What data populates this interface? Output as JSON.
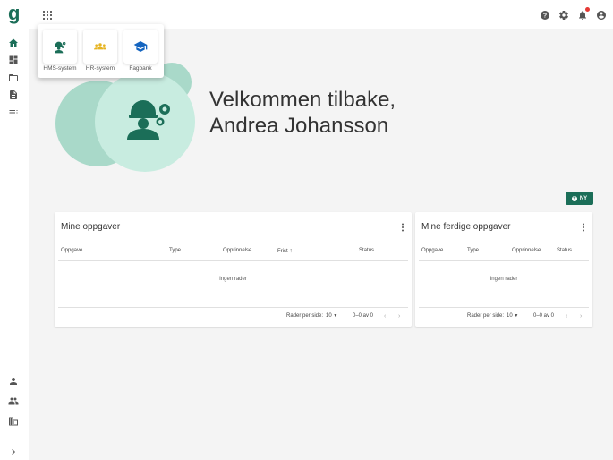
{
  "sidebar": {
    "logo": "g",
    "items": [
      {
        "icon": "home-icon"
      },
      {
        "icon": "dashboard-icon"
      },
      {
        "icon": "folder-icon"
      },
      {
        "icon": "document-icon"
      },
      {
        "icon": "list-icon"
      }
    ],
    "bottom_items": [
      {
        "icon": "person-icon"
      },
      {
        "icon": "people-icon"
      },
      {
        "icon": "building-icon"
      }
    ],
    "expand_icon": "chevron-right-icon"
  },
  "topbar": {
    "icons": [
      "apps-grid-icon",
      "help-icon",
      "settings-icon",
      "notifications-icon",
      "account-icon"
    ]
  },
  "app_menu": {
    "apps": [
      {
        "label": "HMS-system",
        "icon": "worker-gear-icon",
        "color": "#1b6e58"
      },
      {
        "label": "HR-system",
        "icon": "group-icon",
        "color": "#e6b422"
      },
      {
        "label": "Fagbank",
        "icon": "graduation-cap-icon",
        "color": "#1565c0"
      }
    ]
  },
  "welcome": {
    "line1": "Velkommen tilbake,",
    "line2": "Andrea Johansson"
  },
  "new_button": {
    "label": "NY"
  },
  "tasks": {
    "title": "Mine oppgaver",
    "columns": [
      "Oppgave",
      "Type",
      "Opprinnelse",
      "Frist",
      "Status"
    ],
    "sort_column": "Frist",
    "empty": "Ingen rader",
    "rows_per_page_label": "Rader per side:",
    "rows_per_page": "10",
    "range": "0–0 av 0"
  },
  "done_tasks": {
    "title": "Mine ferdige oppgaver",
    "columns": [
      "Oppgave",
      "Type",
      "Opprinnelse",
      "Status"
    ],
    "empty": "Ingen rader",
    "rows_per_page_label": "Rader per side:",
    "rows_per_page": "10",
    "range": "0–0 av 0"
  },
  "colors": {
    "primary": "#1b6e58",
    "hero_light": "#a9d9c9",
    "hero_lighter": "#c8ece0",
    "notification": "#e53935"
  }
}
